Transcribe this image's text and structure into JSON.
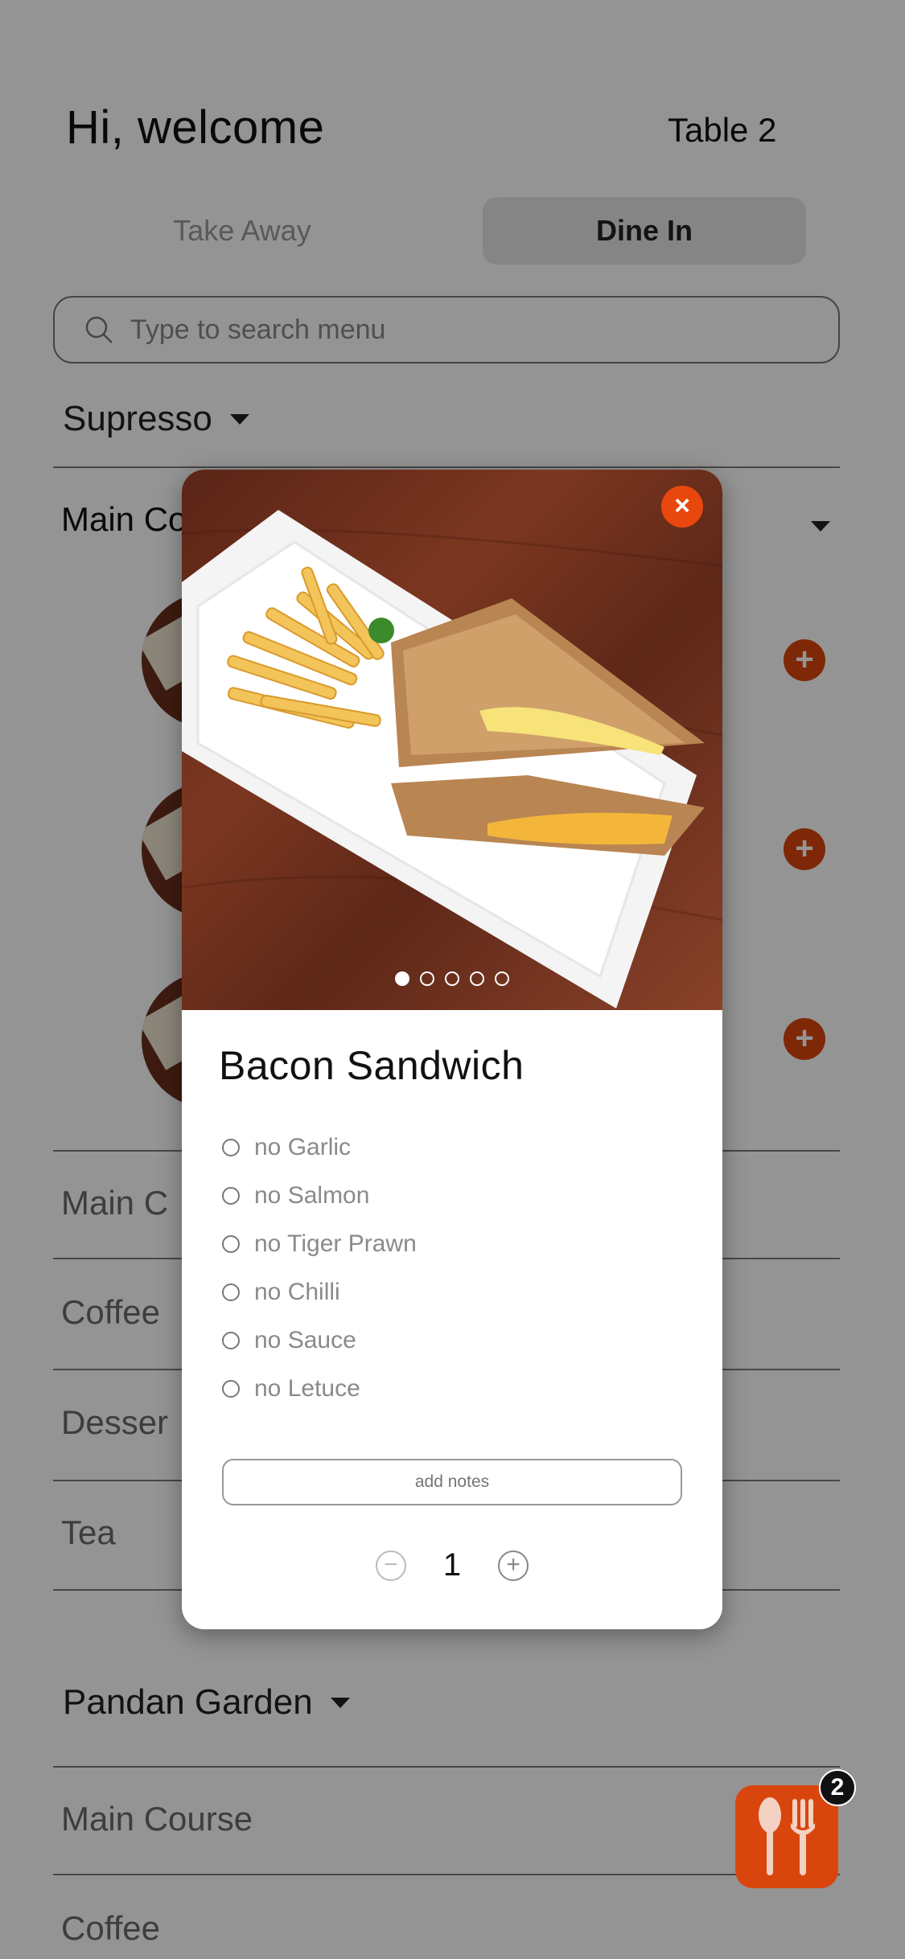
{
  "header": {
    "greeting": "Hi, welcome",
    "table": "Table 2"
  },
  "order_type": {
    "take_away": "Take Away",
    "dine_in": "Dine In",
    "selected": "Dine In"
  },
  "search": {
    "placeholder": "Type to search menu"
  },
  "restaurants": [
    {
      "name": "Supresso"
    },
    {
      "name": "Pandan Garden"
    }
  ],
  "categories_top": {
    "open_label": "Main Co",
    "items": [
      "Main C",
      "Coffee",
      "Desser",
      "Tea"
    ]
  },
  "categories_bottom": [
    "Main Course",
    "Coffee"
  ],
  "cart": {
    "count": "2",
    "icon": "utensils-icon"
  },
  "modal": {
    "title": "Bacon Sandwich",
    "close": "×",
    "options": [
      "no Garlic",
      "no Salmon",
      "no Tiger Prawn",
      "no Chilli",
      "no Sauce",
      "no Letuce"
    ],
    "notes_placeholder": "add notes",
    "quantity": "1",
    "minus": "−",
    "plus": "+",
    "carousel": {
      "total": 5,
      "active": 1
    }
  },
  "colors": {
    "accent": "#d9460d",
    "overlay": "rgba(0,0,0,0.42)"
  }
}
